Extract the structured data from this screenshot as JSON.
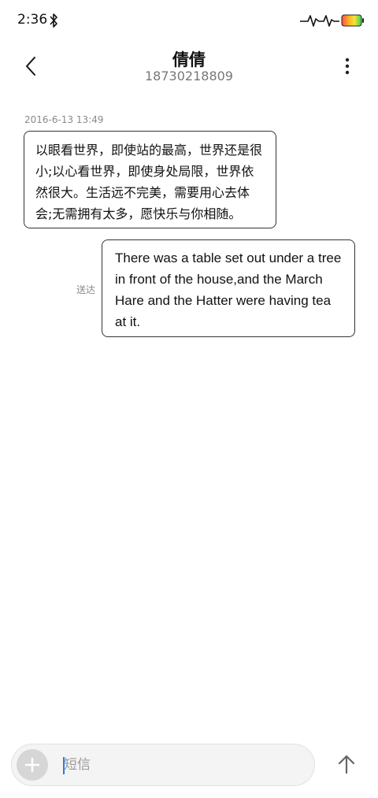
{
  "status_bar": {
    "time": "2:36",
    "bluetooth_icon": "bluetooth-icon",
    "activity_icon": "activity-pulse-icon",
    "battery_icon": "battery-icon"
  },
  "header": {
    "back_icon": "chevron-left-icon",
    "contact_name": "倩倩",
    "contact_number": "18730218809",
    "more_icon": "more-vertical-icon"
  },
  "conversation": {
    "timestamp": "2016-6-13 13:49",
    "incoming": {
      "lines": [
        "以眼看世界，即使站的最高，世界还是很",
        "小;以心看世界，即使身处局限，世界依",
        "然很大。生活远不完美，需要用心去体",
        "会;无需拥有太多，愿快乐与你相随。"
      ]
    },
    "outgoing": {
      "status": "送达",
      "lines": [
        "There was a table set out under a tree",
        "in front of the house,and the March",
        "Hare and the Hatter were having tea",
        "at it."
      ]
    }
  },
  "composer": {
    "add_icon": "plus-icon",
    "placeholder": "短信",
    "value": "",
    "send_icon": "arrow-up-icon"
  },
  "colors": {
    "background": "#ffffff",
    "bubble_border": "#333333",
    "secondary_text": "#8a8a8a",
    "input_background": "#f4f4f4",
    "caret": "#2a7de1"
  }
}
